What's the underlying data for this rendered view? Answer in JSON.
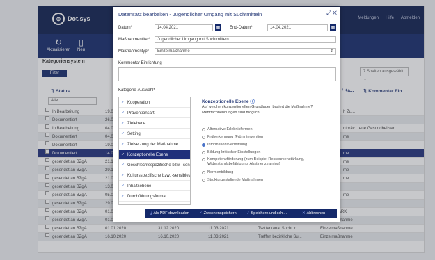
{
  "app": {
    "logo_text": "Dot.sys",
    "topnav": [
      "Meldungen",
      "Hilfe",
      "Abmelden"
    ]
  },
  "toolbar": {
    "refresh_label": "Aktualisieren",
    "new_label": "Neu"
  },
  "sidebar": {
    "title": "Kategoriensystem",
    "filter_label": "Filter"
  },
  "columns_select": "7 Spalten ausgewählt",
  "columns": {
    "status": "Status",
    "kat": "Ka...",
    "kommentar": "Kommentar Ein..."
  },
  "status_filter": "Alle",
  "rows": [
    {
      "status": "In Bearbeitung",
      "c1": "19.0",
      "tail": "h Zu..."
    },
    {
      "status": "Dokumentiert",
      "c1": "26.0",
      "tail": ""
    },
    {
      "status": "In Bearbeitung",
      "c1": "04.0",
      "tail": "ntpräv...  eue Gesundheitsen..."
    },
    {
      "status": "Dokumentiert",
      "c1": "04.0",
      "tail": "me"
    },
    {
      "status": "Dokumentiert",
      "c1": "19.0",
      "tail": ""
    },
    {
      "status": "Dokumentiert",
      "c1": "14.0",
      "tail": "me"
    },
    {
      "status": "gesendet an BZgA",
      "c1": "21.1",
      "tail": "me"
    },
    {
      "status": "gesendet an BZgA",
      "c1": "29.1",
      "tail": "me"
    },
    {
      "status": "gesendet an BZgA",
      "c1": "21.0",
      "tail": "me"
    },
    {
      "status": "gesendet an BZgA",
      "c1": "13.0",
      "tail": ""
    },
    {
      "status": "gesendet an BZgA",
      "c1": "05.0",
      "tail": "me"
    },
    {
      "status": "gesendet an BZgA",
      "c1": "29.0",
      "tail": ""
    },
    {
      "status": "gesendet an BZgA",
      "c1": "01.01.2020",
      "c2": "31.12.2020",
      "c3": "11.03.2021",
      "c4": "Instagramkanal",
      "c5": "BLEIB STARK"
    },
    {
      "status": "gesendet an BZgA",
      "c1": "01.01.2020",
      "c2": "31.12.2020",
      "c3": "11.03.2021",
      "c4": "Facebookseite Sucht...",
      "c5": "Einzelmaßnahme"
    },
    {
      "status": "gesendet an BZgA",
      "c1": "01.01.2020",
      "c2": "31.12.2020",
      "c3": "11.03.2021",
      "c4": "Twitterkanal Sucht.in...",
      "c5": "Einzelmaßnahme"
    },
    {
      "status": "gesendet an BZgA",
      "c1": "16.10.2020",
      "c2": "16.10.2020",
      "c3": "11.03.2021",
      "c4": "Treffen bezirkliche Su...",
      "c5": "Einzelmaßnahme"
    }
  ],
  "modal": {
    "title": "Datensatz bearbeiten - Jugendlicher Umgang mit Suchtmitteln",
    "datum_label": "Datum*",
    "datum_value": "14.04.2021",
    "end_label": "End-Datum*",
    "end_value": "14.04.2021",
    "name_label": "Maßnahmentitel*",
    "name_value": "Jugendlicher Umgang mit Suchtmitteln",
    "typ_label": "Maßnahmentyp*",
    "typ_value": "Einzelmaßnahme",
    "kommentar_label": "Kommentar Einrichtung",
    "kategorie_label": "Kategorie-Auswahl*",
    "categories": [
      "Kooperation",
      "Präventionsart",
      "Zielebene",
      "Setting",
      "Zielsetzung der Maßnahme",
      "Konzeptionelle Ebene",
      "Geschlechtsspezifische bzw. -sen...",
      "Kultursspezifische bzw. -sensible A...",
      "Inhaltsebene",
      "Durchführungsformat"
    ],
    "selected_category": "Konzeptionelle Ebene",
    "detail_title": "Konzeptionelle Ebene",
    "detail_desc": "Auf welchen konzeptionellen Grundlagen basiert die Maßnahme? Mehrfachnennungen sind möglich.",
    "options": [
      {
        "label": "Alternative Erlebnisformen",
        "on": false
      },
      {
        "label": "Früherkennung /Frühintervention",
        "on": false
      },
      {
        "label": "Informationsvermittlung",
        "on": true
      },
      {
        "label": "Bildung kritischer Einstellungen",
        "on": false
      },
      {
        "label": "Kompetenzförderung (zum Beispiel Ressourcenstärkung, Widerstandsbefähigung, Abstinenztraining)",
        "on": false
      },
      {
        "label": "Normenbildung",
        "on": false
      },
      {
        "label": "Strukturgestaltende Maßnahmen",
        "on": false
      }
    ],
    "buttons": {
      "pdf": "Als PDF downloaden",
      "save": "Zwischenspeichern",
      "save_close": "Speichern und schl...",
      "cancel": "Abbrechen"
    }
  },
  "colors": {
    "navy": "#0c1d4e",
    "toolbar": "#14296a",
    "selected": "#1f2f7a",
    "accent": "#4a73c9"
  }
}
